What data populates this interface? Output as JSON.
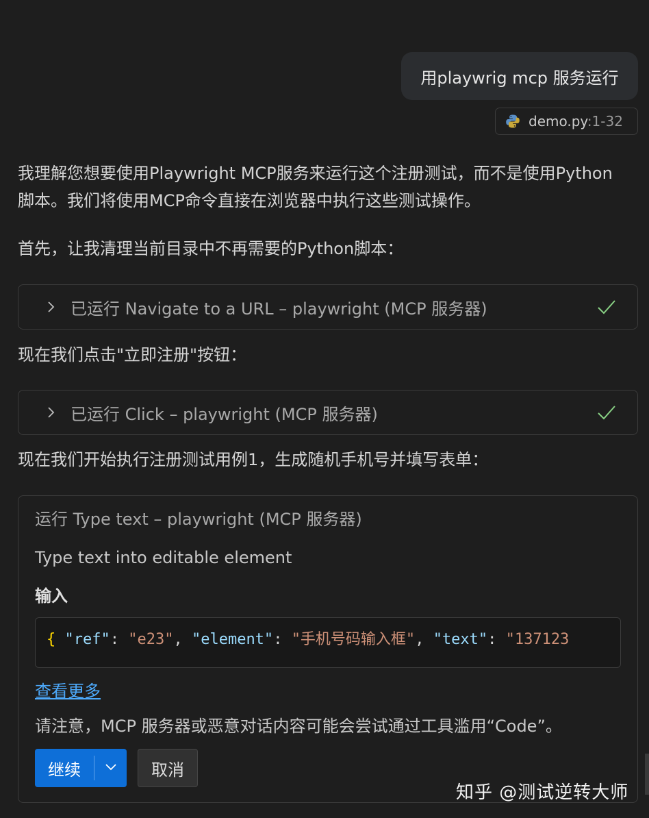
{
  "user_message": {
    "text": "用playwrig mcp 服务运行"
  },
  "file_reference": {
    "icon": "python-icon",
    "filename": "demo.py",
    "range": ":1-32"
  },
  "messages": [
    "我理解您想要使用Playwright MCP服务来运行这个注册测试，而不是使用Python脚本。我们将使用MCP命令直接在浏览器中执行这些测试操作。",
    "首先，让我清理当前目录中不再需要的Python脚本：",
    "现在我们点击\"立即注册\"按钮：",
    "现在我们开始执行注册测试用例1，生成随机手机号并填写表单："
  ],
  "tool_runs": [
    {
      "label": "已运行 Navigate to a URL – playwright (MCP 服务器)",
      "status": "completed"
    },
    {
      "label": "已运行 Click – playwright (MCP 服务器)",
      "status": "completed"
    }
  ],
  "confirmation": {
    "title": "运行 Type text – playwright (MCP 服务器)",
    "description": "Type text into editable element",
    "input_label": "输入",
    "code": {
      "brace": "{",
      "key1": "\"ref\"",
      "val1": "\"e23\"",
      "key2": "\"element\"",
      "val2": "\"手机号码输入框\"",
      "key3": "\"text\"",
      "val3": "\"137123"
    },
    "see_more": "查看更多",
    "warning": "请注意，MCP 服务器或恶意对话内容可能会尝试通过工具滥用“Code”。",
    "continue_label": "继续",
    "cancel_label": "取消"
  },
  "watermark": "知乎 @测试逆转大师",
  "colors": {
    "background": "#1e1e1e",
    "accent": "#0e6fd8",
    "success": "#89d185",
    "link": "#4daafc"
  }
}
